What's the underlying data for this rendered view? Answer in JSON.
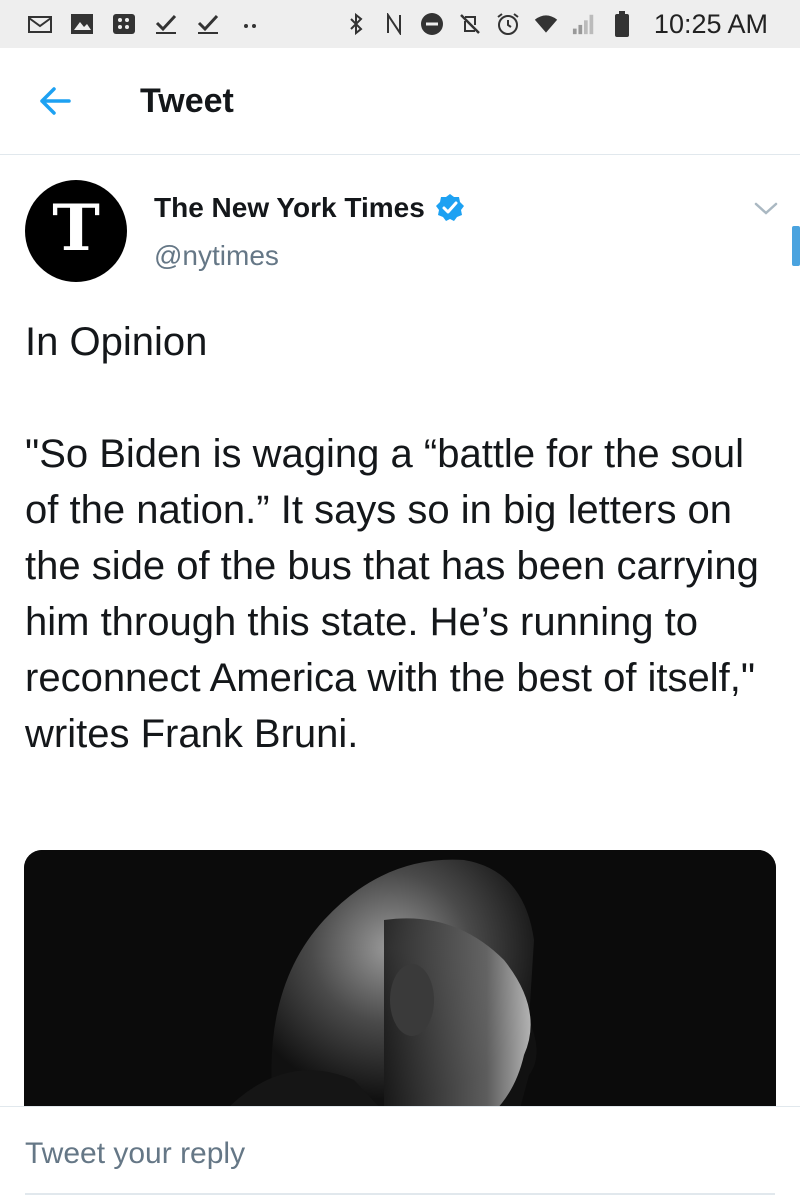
{
  "status_bar": {
    "time": "10:25 AM",
    "left_icons": [
      "mail-icon",
      "image-icon",
      "blackberry-icon",
      "check-icon",
      "check-icon",
      "more-dots-icon"
    ],
    "right_icons": [
      "bluetooth-icon",
      "nfc-icon",
      "do-not-disturb-icon",
      "no-vibrate-icon",
      "alarm-icon",
      "wifi-icon",
      "signal-icon",
      "battery-icon"
    ]
  },
  "header": {
    "title": "Tweet",
    "back_icon": "arrow-left-icon"
  },
  "tweet": {
    "author_name": "The New York Times",
    "author_handle": "@nytimes",
    "avatar_glyph": "T",
    "verified_icon": "verified-badge-icon",
    "text": "In Opinion\n\n\"So Biden is waging a “battle for the soul of the nation.” It says so in big letters on the side of the bus that has been carrying him through this state. He’s running to reconnect America with the best of itself,\" writes Frank Bruni.",
    "media_icon": "photo-icon"
  },
  "reply": {
    "placeholder": "Tweet your reply"
  },
  "colors": {
    "accent": "#1da1f2",
    "text": "#14171a",
    "secondary_text": "#657786",
    "divider": "#e1e8ed",
    "status_bar_bg": "#eeeeee"
  }
}
